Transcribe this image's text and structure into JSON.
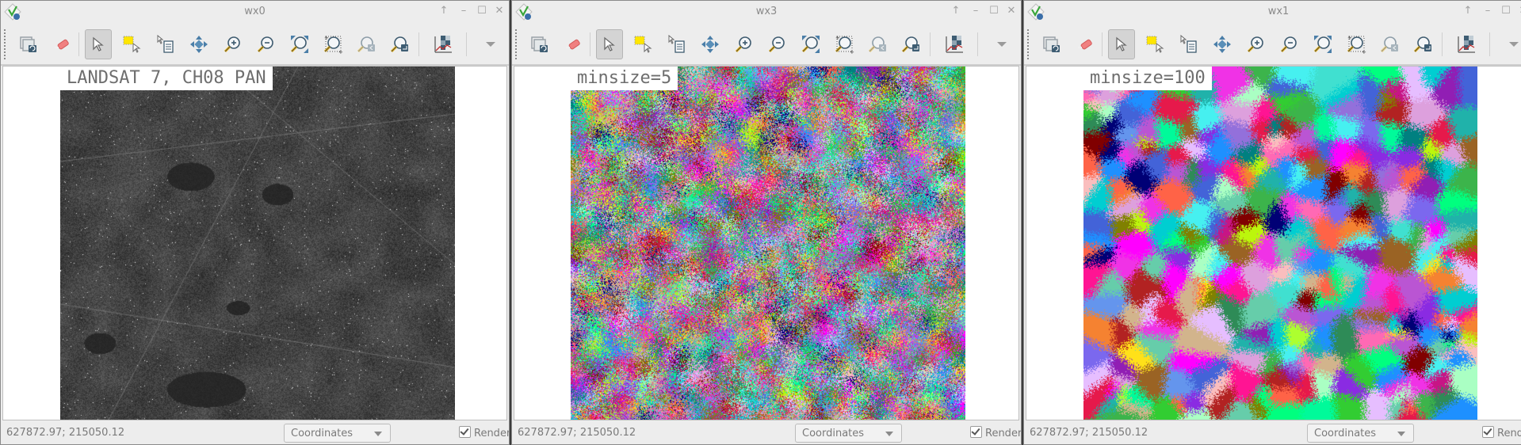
{
  "windows": [
    {
      "id": "wx0",
      "title": "wx0",
      "overlay_label": "LANDSAT 7, CH08 PAN",
      "image_kind": "grayscale-satellite",
      "coordinates": "627872.97; 215050.12",
      "display_mode": "Coordinates",
      "render_label": "Render",
      "render_checked": true
    },
    {
      "id": "wx3",
      "title": "wx3",
      "overlay_label": "minsize=5",
      "image_kind": "segmentation-fine",
      "coordinates": "627872.97; 215050.12",
      "display_mode": "Coordinates",
      "render_label": "Render",
      "render_checked": true
    },
    {
      "id": "wx1",
      "title": "wx1",
      "overlay_label": "minsize=100",
      "image_kind": "segmentation-coarse",
      "coordinates": "627872.97; 215050.12",
      "display_mode": "Coordinates",
      "render_label": "Render",
      "render_checked": true
    }
  ],
  "window_controls": {
    "pin": "↑",
    "minimize": "–",
    "maximize": "☐",
    "close": "✕"
  },
  "toolbar": [
    {
      "name": "display-map-icon",
      "tooltip": "Display map"
    },
    {
      "name": "erase-icon",
      "tooltip": "Erase display"
    },
    {
      "name": "pointer-icon",
      "tooltip": "Pointer",
      "active": true
    },
    {
      "name": "select-icon",
      "tooltip": "Select vector feature"
    },
    {
      "name": "query-icon",
      "tooltip": "Query raster/vector map"
    },
    {
      "name": "pan-icon",
      "tooltip": "Pan"
    },
    {
      "name": "zoom-in-icon",
      "tooltip": "Zoom in"
    },
    {
      "name": "zoom-out-icon",
      "tooltip": "Zoom out"
    },
    {
      "name": "zoom-extent-icon",
      "tooltip": "Zoom to selected map"
    },
    {
      "name": "zoom-region-icon",
      "tooltip": "Zoom to computational region"
    },
    {
      "name": "zoom-back-icon",
      "tooltip": "Return to previous zoom"
    },
    {
      "name": "zoom-menu-icon",
      "tooltip": "Various zoom options"
    },
    {
      "name": "analyze-icon",
      "tooltip": "Analyze"
    },
    {
      "name": "more-icon",
      "tooltip": "More"
    }
  ],
  "segment_palette": [
    "#e6194b",
    "#3cb44b",
    "#ffe119",
    "#4363d8",
    "#f58231",
    "#911eb4",
    "#46f0f0",
    "#f032e6",
    "#bcf60c",
    "#fabebe",
    "#008080",
    "#e6beff",
    "#9a6324",
    "#800000",
    "#aaffc3",
    "#808000",
    "#000075",
    "#ff69b4",
    "#7b68ee",
    "#20b2aa",
    "#32cd32",
    "#ba55d3",
    "#00ced1",
    "#ff6347",
    "#9370db",
    "#66cdaa",
    "#c71585",
    "#6495ed",
    "#00ff7f",
    "#dda0dd",
    "#2e8b57",
    "#ff1493",
    "#1e90ff",
    "#adff2f",
    "#8a2be2",
    "#40e0d0",
    "#d2b48c",
    "#b22222",
    "#00fa9a",
    "#ff00ff"
  ]
}
